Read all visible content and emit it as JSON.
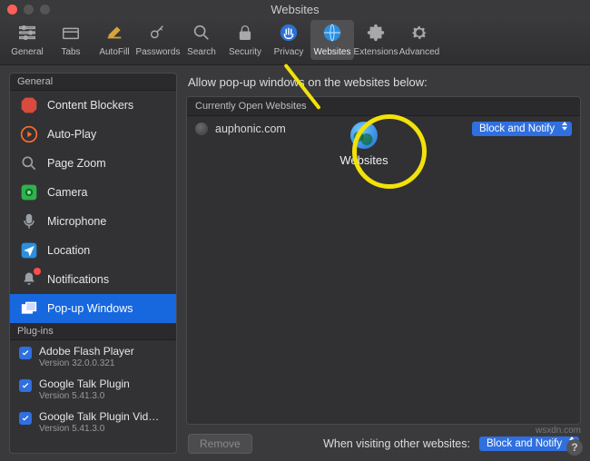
{
  "window": {
    "title": "Websites"
  },
  "toolbar": {
    "items": [
      {
        "key": "general",
        "label": "General"
      },
      {
        "key": "tabs",
        "label": "Tabs"
      },
      {
        "key": "autofill",
        "label": "AutoFill"
      },
      {
        "key": "passwords",
        "label": "Passwords"
      },
      {
        "key": "search",
        "label": "Search"
      },
      {
        "key": "security",
        "label": "Security"
      },
      {
        "key": "privacy",
        "label": "Privacy"
      },
      {
        "key": "websites",
        "label": "Websites"
      },
      {
        "key": "extensions",
        "label": "Extensions"
      },
      {
        "key": "advanced",
        "label": "Advanced"
      }
    ],
    "selected": "websites"
  },
  "sidebar": {
    "sections": {
      "general_header": "General",
      "plugins_header": "Plug-ins"
    },
    "general": [
      {
        "key": "content-blockers",
        "label": "Content Blockers"
      },
      {
        "key": "auto-play",
        "label": "Auto-Play"
      },
      {
        "key": "page-zoom",
        "label": "Page Zoom"
      },
      {
        "key": "camera",
        "label": "Camera"
      },
      {
        "key": "microphone",
        "label": "Microphone"
      },
      {
        "key": "location",
        "label": "Location"
      },
      {
        "key": "notifications",
        "label": "Notifications",
        "badge": true
      },
      {
        "key": "pop-up-windows",
        "label": "Pop-up Windows",
        "selected": true
      }
    ],
    "plugins": [
      {
        "key": "flash",
        "name": "Adobe Flash Player",
        "version": "Version 32.0.0.321",
        "checked": true
      },
      {
        "key": "gtalk",
        "name": "Google Talk Plugin",
        "version": "Version 5.41.3.0",
        "checked": true
      },
      {
        "key": "gtalkv",
        "name": "Google Talk Plugin Vid…",
        "version": "Version 5.41.3.0",
        "checked": true
      }
    ]
  },
  "main": {
    "title": "Allow pop-up windows on the websites below:",
    "section_header": "Currently Open Websites",
    "rows": [
      {
        "site": "auphonic.com",
        "option": "Block and Notify"
      }
    ],
    "remove_label": "Remove",
    "footer_label": "When visiting other websites:",
    "footer_option": "Block and Notify"
  },
  "callout": {
    "label": "Websites"
  },
  "help": {
    "label": "?"
  },
  "watermark": "wsxdn.com"
}
